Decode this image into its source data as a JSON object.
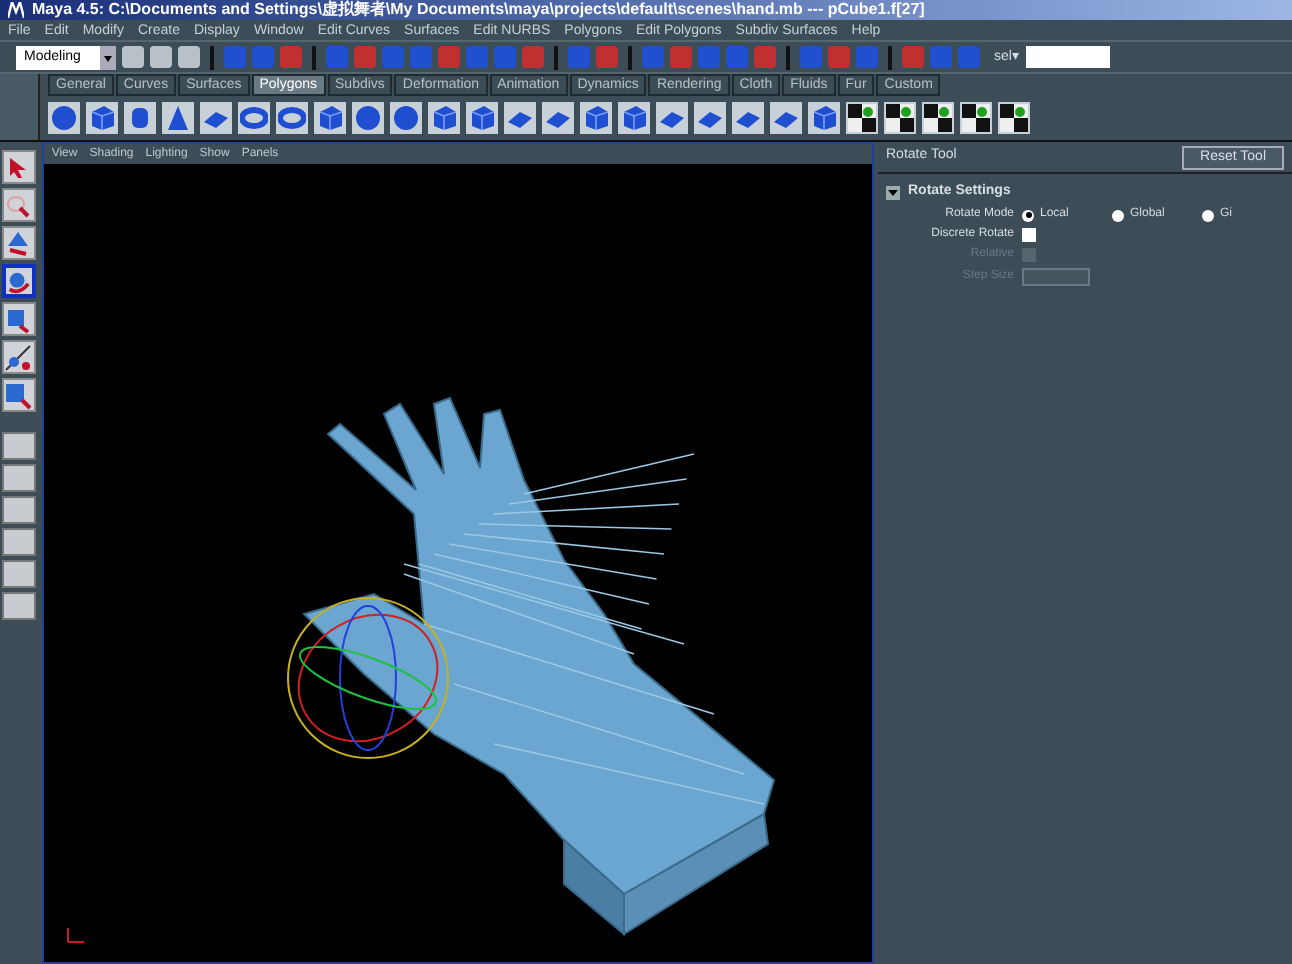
{
  "window": {
    "title": "Maya 4.5: C:\\Documents and Settings\\虚拟舞者\\My Documents\\maya\\projects\\default\\scenes\\hand.mb  ---  pCube1.f[27]"
  },
  "menu_bar": [
    "File",
    "Edit",
    "Modify",
    "Create",
    "Display",
    "Window",
    "Edit Curves",
    "Surfaces",
    "Edit NURBS",
    "Polygons",
    "Edit Polygons",
    "Subdiv Surfaces",
    "Help"
  ],
  "status_line": {
    "menu_set": "Modeling",
    "selection_label": "sel▾"
  },
  "shelf_tabs": [
    {
      "label": "General",
      "selected": false
    },
    {
      "label": "Curves",
      "selected": false
    },
    {
      "label": "Surfaces",
      "selected": false
    },
    {
      "label": "Polygons",
      "selected": true
    },
    {
      "label": "Subdivs",
      "selected": false
    },
    {
      "label": "Deformation",
      "selected": false
    },
    {
      "label": "Animation",
      "selected": false
    },
    {
      "label": "Dynamics",
      "selected": false
    },
    {
      "label": "Rendering",
      "selected": false
    },
    {
      "label": "Cloth",
      "selected": false
    },
    {
      "label": "Fluids",
      "selected": false
    },
    {
      "label": "Fur",
      "selected": false
    },
    {
      "label": "Custom",
      "selected": false
    }
  ],
  "toolbox": [
    {
      "kind": "select",
      "selected": false
    },
    {
      "kind": "lasso",
      "selected": false
    },
    {
      "kind": "move",
      "selected": false
    },
    {
      "kind": "rotate",
      "selected": true
    },
    {
      "kind": "scale",
      "selected": false
    },
    {
      "kind": "manipulator",
      "selected": false
    },
    {
      "kind": "last",
      "selected": false
    }
  ],
  "viewport": {
    "menus": [
      "View",
      "Shading",
      "Lighting",
      "Show",
      "Panels"
    ]
  },
  "tool_settings": {
    "title": "Rotate Tool",
    "reset_button": "Reset Tool",
    "section": "Rotate Settings",
    "rotate_mode": {
      "label": "Rotate Mode",
      "options": [
        {
          "label": "Local",
          "selected": true
        },
        {
          "label": "Global",
          "selected": false
        },
        {
          "label": "Gi",
          "selected": false
        }
      ]
    },
    "discrete_rotate": {
      "label": "Discrete Rotate",
      "checked": false
    },
    "relative": {
      "label": "Relative",
      "checked": false,
      "disabled": true
    },
    "step_size": {
      "label": "Step Size",
      "disabled": true
    }
  }
}
